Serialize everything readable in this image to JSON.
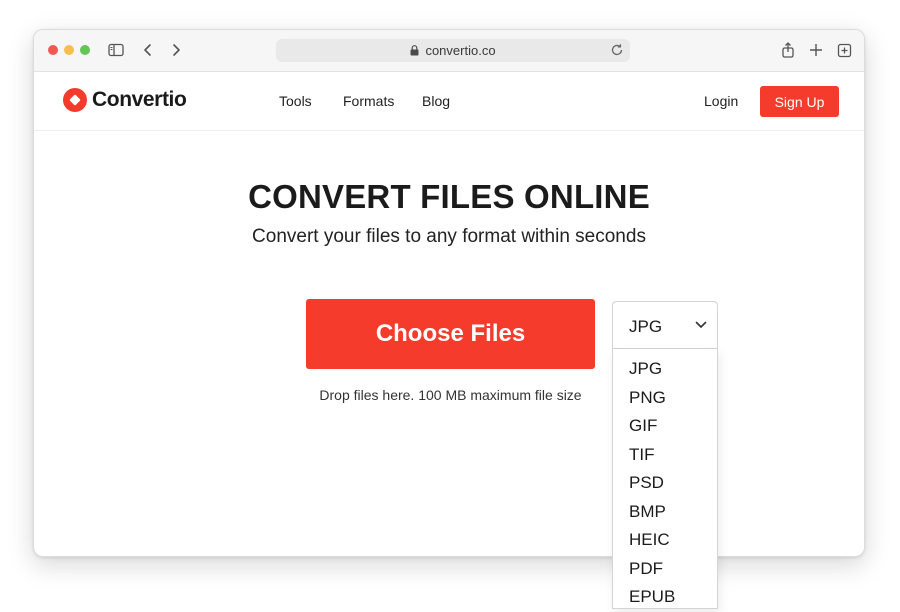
{
  "browser": {
    "url": "convertio.co"
  },
  "colors": {
    "brand": "#f43b2c",
    "close": "#ee5a52",
    "minimize": "#f5be4f",
    "zoom": "#62c554"
  },
  "nav": {
    "logo_text": "Convertio",
    "links": [
      "Tools",
      "Formats",
      "Blog"
    ],
    "login": "Login",
    "signup": "Sign Up"
  },
  "hero": {
    "title": "CONVERT FILES ONLINE",
    "subtitle": "Convert your files to any format within seconds"
  },
  "upload": {
    "button": "Choose Files",
    "hint": "Drop files here. 100 MB maximum file size"
  },
  "format_select": {
    "selected": "JPG",
    "options": [
      "JPG",
      "PNG",
      "GIF",
      "TIF",
      "PSD",
      "BMP",
      "HEIC",
      "PDF",
      "EPUB"
    ]
  },
  "icons": [
    "sidebar-toggle-icon",
    "back-icon",
    "forward-icon",
    "lock-icon",
    "reload-icon",
    "share-icon",
    "new-tab-icon",
    "tabs-overview-icon",
    "chevron-down-icon"
  ]
}
